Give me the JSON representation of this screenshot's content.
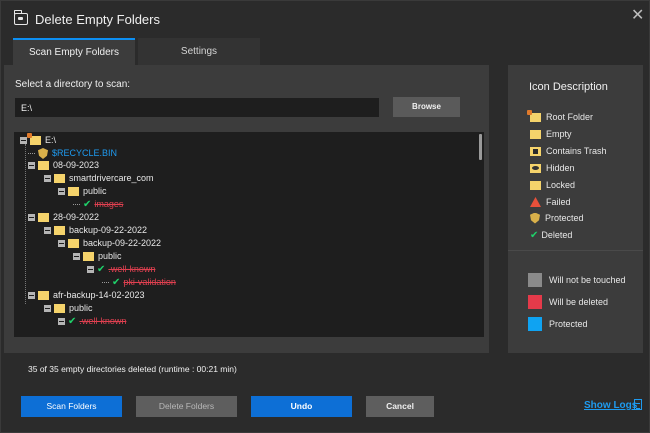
{
  "window": {
    "title": "Delete Empty Folders",
    "close_glyph": "✕",
    "icon": "app-folder-icon"
  },
  "tabs": [
    {
      "label": "Scan Empty Folders",
      "active": true
    },
    {
      "label": "Settings",
      "active": false
    }
  ],
  "scan": {
    "dir_label": "Select a directory to scan:",
    "dir_value": "E:\\",
    "browse_label": "Browse"
  },
  "tree": [
    {
      "label": "E:\\",
      "icon": "root-folder-icon",
      "status": "normal"
    },
    {
      "label": "$RECYCLE.BIN",
      "icon": "protected-icon",
      "status": "protected"
    },
    {
      "label": "08-09-2023",
      "icon": "folder-icon",
      "status": "normal"
    },
    {
      "label": "smartdrivercare_com",
      "icon": "folder-icon",
      "status": "normal"
    },
    {
      "label": "public",
      "icon": "folder-icon",
      "status": "normal"
    },
    {
      "label": "images",
      "icon": "deleted-check-icon",
      "status": "deleted"
    },
    {
      "label": "28-09-2022",
      "icon": "folder-icon",
      "status": "normal"
    },
    {
      "label": "backup-09-22-2022",
      "icon": "folder-icon",
      "status": "normal"
    },
    {
      "label": "backup-09-22-2022",
      "icon": "folder-icon",
      "status": "normal"
    },
    {
      "label": "public",
      "icon": "folder-icon",
      "status": "normal"
    },
    {
      "label": ".well-known",
      "icon": "deleted-check-icon",
      "status": "deleted"
    },
    {
      "label": "pki-validation",
      "icon": "deleted-check-icon",
      "status": "deleted"
    },
    {
      "label": "afr-backup-14-02-2023",
      "icon": "folder-icon",
      "status": "normal"
    },
    {
      "label": "public",
      "icon": "folder-icon",
      "status": "normal"
    },
    {
      "label": ".well-known",
      "icon": "deleted-check-icon",
      "status": "deleted"
    }
  ],
  "icon_description": {
    "title": "Icon Description",
    "items": [
      {
        "label": "Root Folder",
        "icon": "root-folder-icon"
      },
      {
        "label": "Empty",
        "icon": "empty-folder-icon"
      },
      {
        "label": "Contains Trash",
        "icon": "trash-folder-icon"
      },
      {
        "label": "Hidden",
        "icon": "hidden-folder-icon"
      },
      {
        "label": "Locked",
        "icon": "locked-folder-icon"
      },
      {
        "label": "Failed",
        "icon": "failed-warning-icon"
      },
      {
        "label": "Protected",
        "icon": "protected-shield-icon"
      },
      {
        "label": "Deleted",
        "icon": "deleted-check-icon"
      }
    ],
    "legend": [
      {
        "label": "Will not be touched",
        "color": "#8a8a8a"
      },
      {
        "label": "Will be deleted",
        "color": "#e53a4a"
      },
      {
        "label": "Protected",
        "color": "#0fa3f2"
      }
    ]
  },
  "status_text": "35 of 35 empty directories deleted (runtime : 00:21 min)",
  "buttons": {
    "scan": "Scan Folders",
    "delete": "Delete Folders",
    "undo": "Undo",
    "cancel": "Cancel",
    "show_logs": "Show Logs"
  },
  "colors": {
    "accent": "#0d6fd6",
    "deleted": "#e04050",
    "protected": "#1e9bf0",
    "check": "#1fd16a"
  }
}
